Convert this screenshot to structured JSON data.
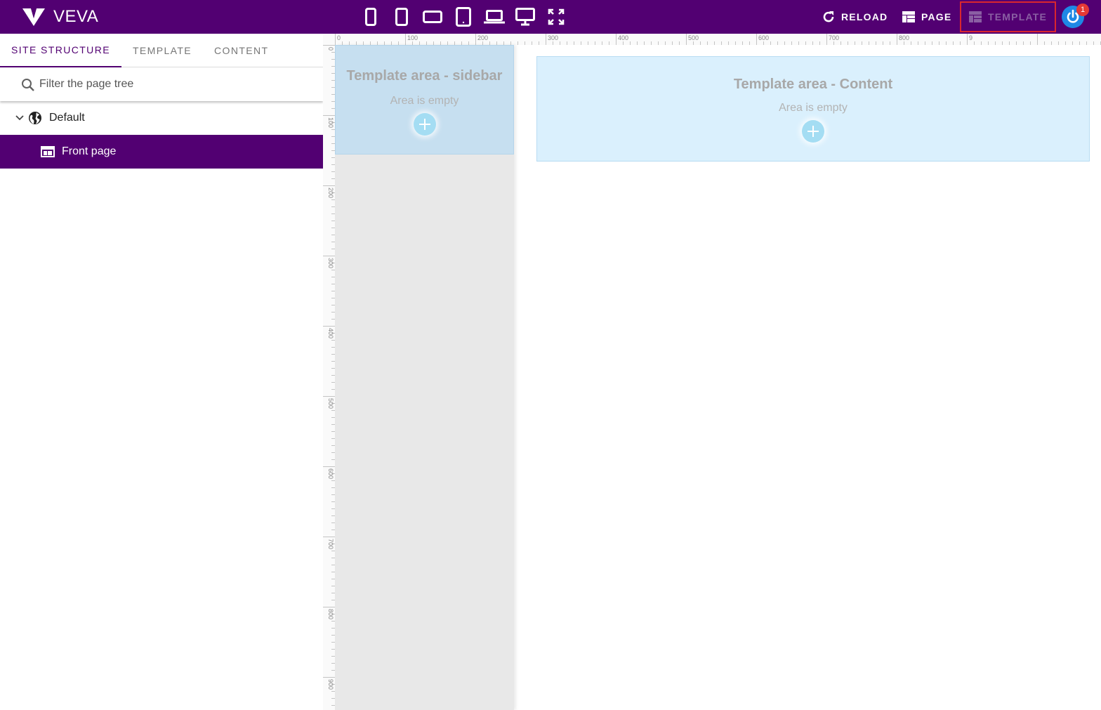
{
  "app": {
    "name": "VEVA"
  },
  "topbar": {
    "devices": [
      {
        "name": "mobile-portrait"
      },
      {
        "name": "mobile-large"
      },
      {
        "name": "mobile-landscape"
      },
      {
        "name": "tablet"
      },
      {
        "name": "laptop"
      },
      {
        "name": "desktop"
      },
      {
        "name": "fullscreen"
      }
    ],
    "reload_label": "RELOAD",
    "page_label": "PAGE",
    "template_label": "TEMPLATE",
    "notification_count": "1"
  },
  "leftpanel": {
    "tabs": [
      {
        "label": "SITE STRUCTURE",
        "active": true
      },
      {
        "label": "TEMPLATE",
        "active": false
      },
      {
        "label": "CONTENT",
        "active": false
      }
    ],
    "filter_placeholder": "Filter the page tree",
    "tree": {
      "root": "Default",
      "selected_page": "Front page"
    }
  },
  "canvas": {
    "ruler_top": [
      "0",
      "100",
      "200",
      "300",
      "400",
      "500",
      "600",
      "700",
      "800",
      "9"
    ],
    "ruler_left": [
      "0",
      "100",
      "200",
      "300",
      "400",
      "500",
      "600",
      "700",
      "800",
      "900"
    ],
    "areas": {
      "sidebar": {
        "title": "Template area - sidebar",
        "status": "Area is empty"
      },
      "content": {
        "title": "Template area - Content",
        "status": "Area is empty"
      }
    }
  },
  "colors": {
    "brand": "#520072",
    "highlight": "#d9262e",
    "add": "#a4ddf3"
  }
}
